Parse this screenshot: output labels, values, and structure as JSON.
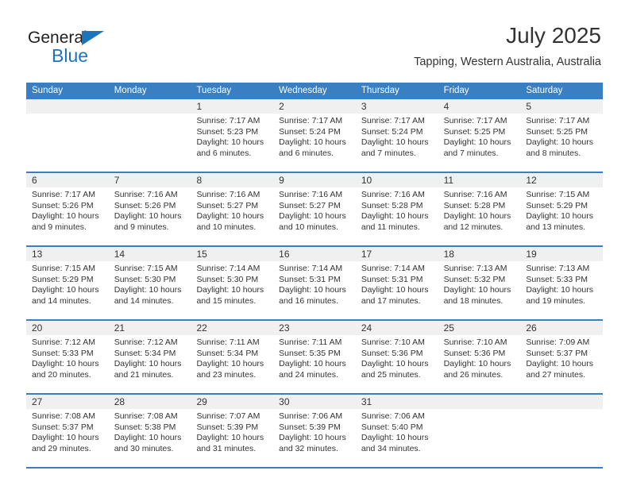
{
  "brand": {
    "name_top": "General",
    "name_bottom": "Blue",
    "accent_color": "#1b75bb"
  },
  "header": {
    "title": "July 2025",
    "subtitle": "Tapping, Western Australia, Australia"
  },
  "calendar": {
    "header_color": "#3a7fc1",
    "weekdays": [
      "Sunday",
      "Monday",
      "Tuesday",
      "Wednesday",
      "Thursday",
      "Friday",
      "Saturday"
    ],
    "weeks": [
      [
        {
          "day": "",
          "sunrise": "",
          "sunset": "",
          "daylight1": "",
          "daylight2": ""
        },
        {
          "day": "",
          "sunrise": "",
          "sunset": "",
          "daylight1": "",
          "daylight2": ""
        },
        {
          "day": "1",
          "sunrise": "Sunrise: 7:17 AM",
          "sunset": "Sunset: 5:23 PM",
          "daylight1": "Daylight: 10 hours",
          "daylight2": "and 6 minutes."
        },
        {
          "day": "2",
          "sunrise": "Sunrise: 7:17 AM",
          "sunset": "Sunset: 5:24 PM",
          "daylight1": "Daylight: 10 hours",
          "daylight2": "and 6 minutes."
        },
        {
          "day": "3",
          "sunrise": "Sunrise: 7:17 AM",
          "sunset": "Sunset: 5:24 PM",
          "daylight1": "Daylight: 10 hours",
          "daylight2": "and 7 minutes."
        },
        {
          "day": "4",
          "sunrise": "Sunrise: 7:17 AM",
          "sunset": "Sunset: 5:25 PM",
          "daylight1": "Daylight: 10 hours",
          "daylight2": "and 7 minutes."
        },
        {
          "day": "5",
          "sunrise": "Sunrise: 7:17 AM",
          "sunset": "Sunset: 5:25 PM",
          "daylight1": "Daylight: 10 hours",
          "daylight2": "and 8 minutes."
        }
      ],
      [
        {
          "day": "6",
          "sunrise": "Sunrise: 7:17 AM",
          "sunset": "Sunset: 5:26 PM",
          "daylight1": "Daylight: 10 hours",
          "daylight2": "and 9 minutes."
        },
        {
          "day": "7",
          "sunrise": "Sunrise: 7:16 AM",
          "sunset": "Sunset: 5:26 PM",
          "daylight1": "Daylight: 10 hours",
          "daylight2": "and 9 minutes."
        },
        {
          "day": "8",
          "sunrise": "Sunrise: 7:16 AM",
          "sunset": "Sunset: 5:27 PM",
          "daylight1": "Daylight: 10 hours",
          "daylight2": "and 10 minutes."
        },
        {
          "day": "9",
          "sunrise": "Sunrise: 7:16 AM",
          "sunset": "Sunset: 5:27 PM",
          "daylight1": "Daylight: 10 hours",
          "daylight2": "and 10 minutes."
        },
        {
          "day": "10",
          "sunrise": "Sunrise: 7:16 AM",
          "sunset": "Sunset: 5:28 PM",
          "daylight1": "Daylight: 10 hours",
          "daylight2": "and 11 minutes."
        },
        {
          "day": "11",
          "sunrise": "Sunrise: 7:16 AM",
          "sunset": "Sunset: 5:28 PM",
          "daylight1": "Daylight: 10 hours",
          "daylight2": "and 12 minutes."
        },
        {
          "day": "12",
          "sunrise": "Sunrise: 7:15 AM",
          "sunset": "Sunset: 5:29 PM",
          "daylight1": "Daylight: 10 hours",
          "daylight2": "and 13 minutes."
        }
      ],
      [
        {
          "day": "13",
          "sunrise": "Sunrise: 7:15 AM",
          "sunset": "Sunset: 5:29 PM",
          "daylight1": "Daylight: 10 hours",
          "daylight2": "and 14 minutes."
        },
        {
          "day": "14",
          "sunrise": "Sunrise: 7:15 AM",
          "sunset": "Sunset: 5:30 PM",
          "daylight1": "Daylight: 10 hours",
          "daylight2": "and 14 minutes."
        },
        {
          "day": "15",
          "sunrise": "Sunrise: 7:14 AM",
          "sunset": "Sunset: 5:30 PM",
          "daylight1": "Daylight: 10 hours",
          "daylight2": "and 15 minutes."
        },
        {
          "day": "16",
          "sunrise": "Sunrise: 7:14 AM",
          "sunset": "Sunset: 5:31 PM",
          "daylight1": "Daylight: 10 hours",
          "daylight2": "and 16 minutes."
        },
        {
          "day": "17",
          "sunrise": "Sunrise: 7:14 AM",
          "sunset": "Sunset: 5:31 PM",
          "daylight1": "Daylight: 10 hours",
          "daylight2": "and 17 minutes."
        },
        {
          "day": "18",
          "sunrise": "Sunrise: 7:13 AM",
          "sunset": "Sunset: 5:32 PM",
          "daylight1": "Daylight: 10 hours",
          "daylight2": "and 18 minutes."
        },
        {
          "day": "19",
          "sunrise": "Sunrise: 7:13 AM",
          "sunset": "Sunset: 5:33 PM",
          "daylight1": "Daylight: 10 hours",
          "daylight2": "and 19 minutes."
        }
      ],
      [
        {
          "day": "20",
          "sunrise": "Sunrise: 7:12 AM",
          "sunset": "Sunset: 5:33 PM",
          "daylight1": "Daylight: 10 hours",
          "daylight2": "and 20 minutes."
        },
        {
          "day": "21",
          "sunrise": "Sunrise: 7:12 AM",
          "sunset": "Sunset: 5:34 PM",
          "daylight1": "Daylight: 10 hours",
          "daylight2": "and 21 minutes."
        },
        {
          "day": "22",
          "sunrise": "Sunrise: 7:11 AM",
          "sunset": "Sunset: 5:34 PM",
          "daylight1": "Daylight: 10 hours",
          "daylight2": "and 23 minutes."
        },
        {
          "day": "23",
          "sunrise": "Sunrise: 7:11 AM",
          "sunset": "Sunset: 5:35 PM",
          "daylight1": "Daylight: 10 hours",
          "daylight2": "and 24 minutes."
        },
        {
          "day": "24",
          "sunrise": "Sunrise: 7:10 AM",
          "sunset": "Sunset: 5:36 PM",
          "daylight1": "Daylight: 10 hours",
          "daylight2": "and 25 minutes."
        },
        {
          "day": "25",
          "sunrise": "Sunrise: 7:10 AM",
          "sunset": "Sunset: 5:36 PM",
          "daylight1": "Daylight: 10 hours",
          "daylight2": "and 26 minutes."
        },
        {
          "day": "26",
          "sunrise": "Sunrise: 7:09 AM",
          "sunset": "Sunset: 5:37 PM",
          "daylight1": "Daylight: 10 hours",
          "daylight2": "and 27 minutes."
        }
      ],
      [
        {
          "day": "27",
          "sunrise": "Sunrise: 7:08 AM",
          "sunset": "Sunset: 5:37 PM",
          "daylight1": "Daylight: 10 hours",
          "daylight2": "and 29 minutes."
        },
        {
          "day": "28",
          "sunrise": "Sunrise: 7:08 AM",
          "sunset": "Sunset: 5:38 PM",
          "daylight1": "Daylight: 10 hours",
          "daylight2": "and 30 minutes."
        },
        {
          "day": "29",
          "sunrise": "Sunrise: 7:07 AM",
          "sunset": "Sunset: 5:39 PM",
          "daylight1": "Daylight: 10 hours",
          "daylight2": "and 31 minutes."
        },
        {
          "day": "30",
          "sunrise": "Sunrise: 7:06 AM",
          "sunset": "Sunset: 5:39 PM",
          "daylight1": "Daylight: 10 hours",
          "daylight2": "and 32 minutes."
        },
        {
          "day": "31",
          "sunrise": "Sunrise: 7:06 AM",
          "sunset": "Sunset: 5:40 PM",
          "daylight1": "Daylight: 10 hours",
          "daylight2": "and 34 minutes."
        },
        {
          "day": "",
          "sunrise": "",
          "sunset": "",
          "daylight1": "",
          "daylight2": ""
        },
        {
          "day": "",
          "sunrise": "",
          "sunset": "",
          "daylight1": "",
          "daylight2": ""
        }
      ]
    ]
  }
}
